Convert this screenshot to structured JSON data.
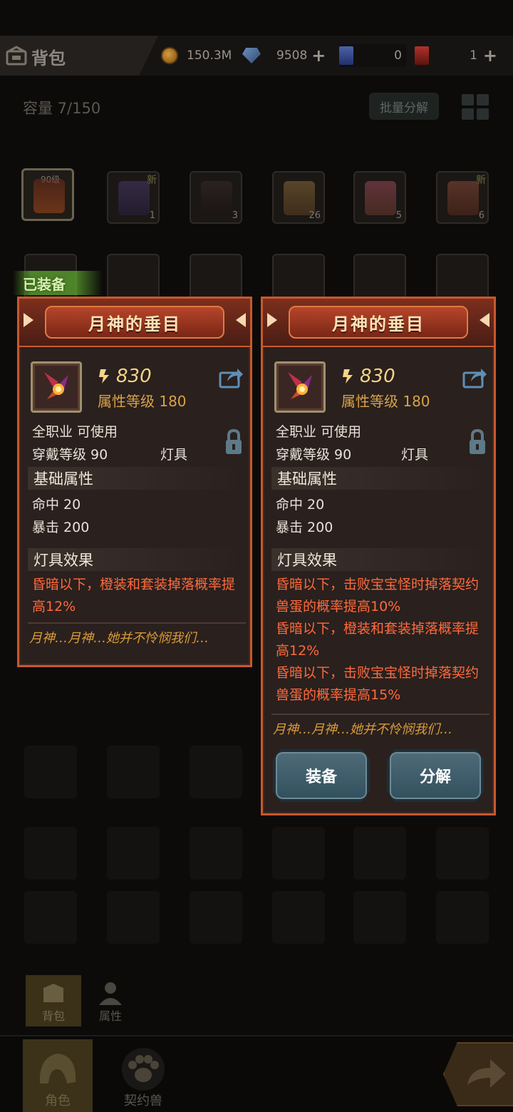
{
  "header": {
    "title": "背包",
    "gold": "150.3M",
    "gems": "9508",
    "blue_ticket": "0",
    "red_ticket": "1"
  },
  "inventory": {
    "capacity": "容量 7/150",
    "bulk_button": "批量分解",
    "equipped_tag": "已装备",
    "row1": [
      {
        "level": "90级",
        "count": "",
        "new": ""
      },
      {
        "level": "",
        "count": "1",
        "new": "新"
      },
      {
        "level": "",
        "count": "3",
        "new": ""
      },
      {
        "level": "",
        "count": "26",
        "new": ""
      },
      {
        "level": "",
        "count": "5",
        "new": ""
      },
      {
        "level": "",
        "count": "6",
        "new": "新"
      }
    ]
  },
  "cards": [
    {
      "name": "月神的垂目",
      "power": "830",
      "attr_level": "属性等级 180",
      "class_req": "全职业 可使用",
      "wear_level": "穿戴等级 90",
      "type": "灯具",
      "base_header": "基础属性",
      "stats": [
        "命中  20",
        "暴击  200"
      ],
      "effect_header": "灯具效果",
      "effects": [
        "昏暗以下，橙装和套装掉落概率提高12%"
      ],
      "flavor": "月神…月神…她并不怜悯我们…"
    },
    {
      "name": "月神的垂目",
      "power": "830",
      "attr_level": "属性等级 180",
      "class_req": "全职业 可使用",
      "wear_level": "穿戴等级 90",
      "type": "灯具",
      "base_header": "基础属性",
      "stats": [
        "命中  20",
        "暴击  200"
      ],
      "effect_header": "灯具效果",
      "effects": [
        "昏暗以下，击败宝宝怪时掉落契约兽蛋的概率提高10%",
        "昏暗以下，橙装和套装掉落概率提高12%",
        "昏暗以下，击败宝宝怪时掉落契约兽蛋的概率提高15%"
      ],
      "flavor": "月神…月神…她并不怜悯我们…",
      "equip_button": "装备",
      "dismantle_button": "分解"
    }
  ],
  "sub_tabs": [
    "背包",
    "属性"
  ],
  "bottom_nav": [
    "角色",
    "契约兽"
  ]
}
